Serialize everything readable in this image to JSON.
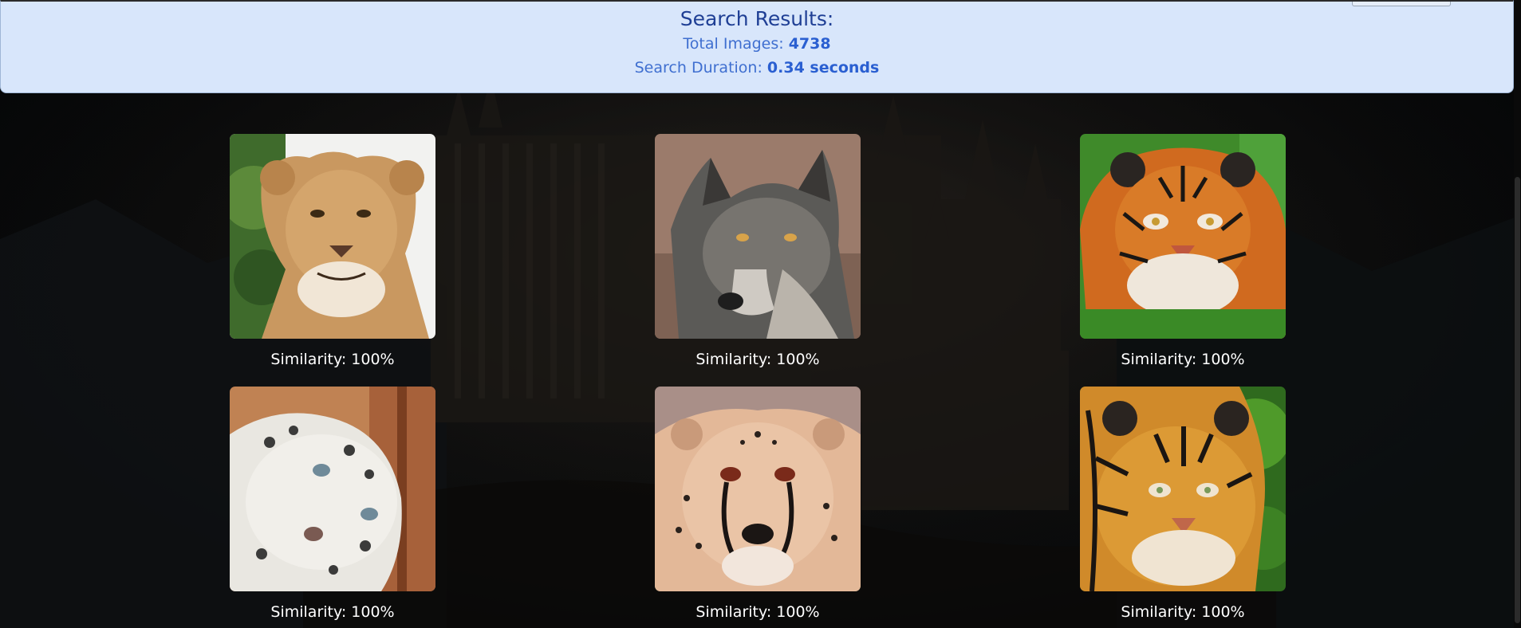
{
  "header": {
    "title": "Search Results:",
    "total_label": "Total Images: ",
    "total_value": "4738",
    "duration_label": "Search Duration: ",
    "duration_value": "0.34 seconds"
  },
  "results": [
    {
      "animal": "lioness",
      "similarity": "Similarity: 100%"
    },
    {
      "animal": "wolf",
      "similarity": "Similarity: 100%"
    },
    {
      "animal": "tiger",
      "similarity": "Similarity: 100%"
    },
    {
      "animal": "snow-leopard",
      "similarity": "Similarity: 100%"
    },
    {
      "animal": "cheetah",
      "similarity": "Similarity: 100%"
    },
    {
      "animal": "tiger",
      "similarity": "Similarity: 100%"
    }
  ],
  "colors": {
    "header_bg": "#d8e6fb",
    "title": "#1f3f95",
    "accent": "#2a5fd1"
  }
}
